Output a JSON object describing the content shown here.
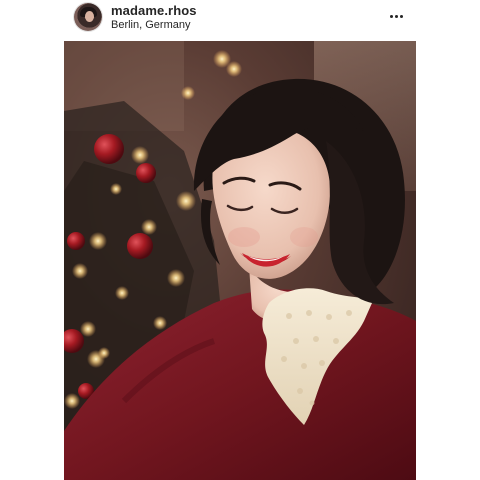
{
  "post": {
    "username": "madame.rhos",
    "location": "Berlin, Germany",
    "avatar_icon": "profile-avatar",
    "more_icon": "more-options-icon",
    "photo": {
      "subject": "smiling woman with dark curled hair, red lipstick, burgundy sweater and cream lace collar",
      "background": "Christmas tree with warm fairy lights and red baubles",
      "palette": {
        "sweater": "#7a1a26",
        "hair": "#1c1412",
        "skin": "#e8c0ae",
        "lace": "#efe3cc",
        "lights": "#ffd98a",
        "bauble": "#a51a22"
      }
    }
  }
}
